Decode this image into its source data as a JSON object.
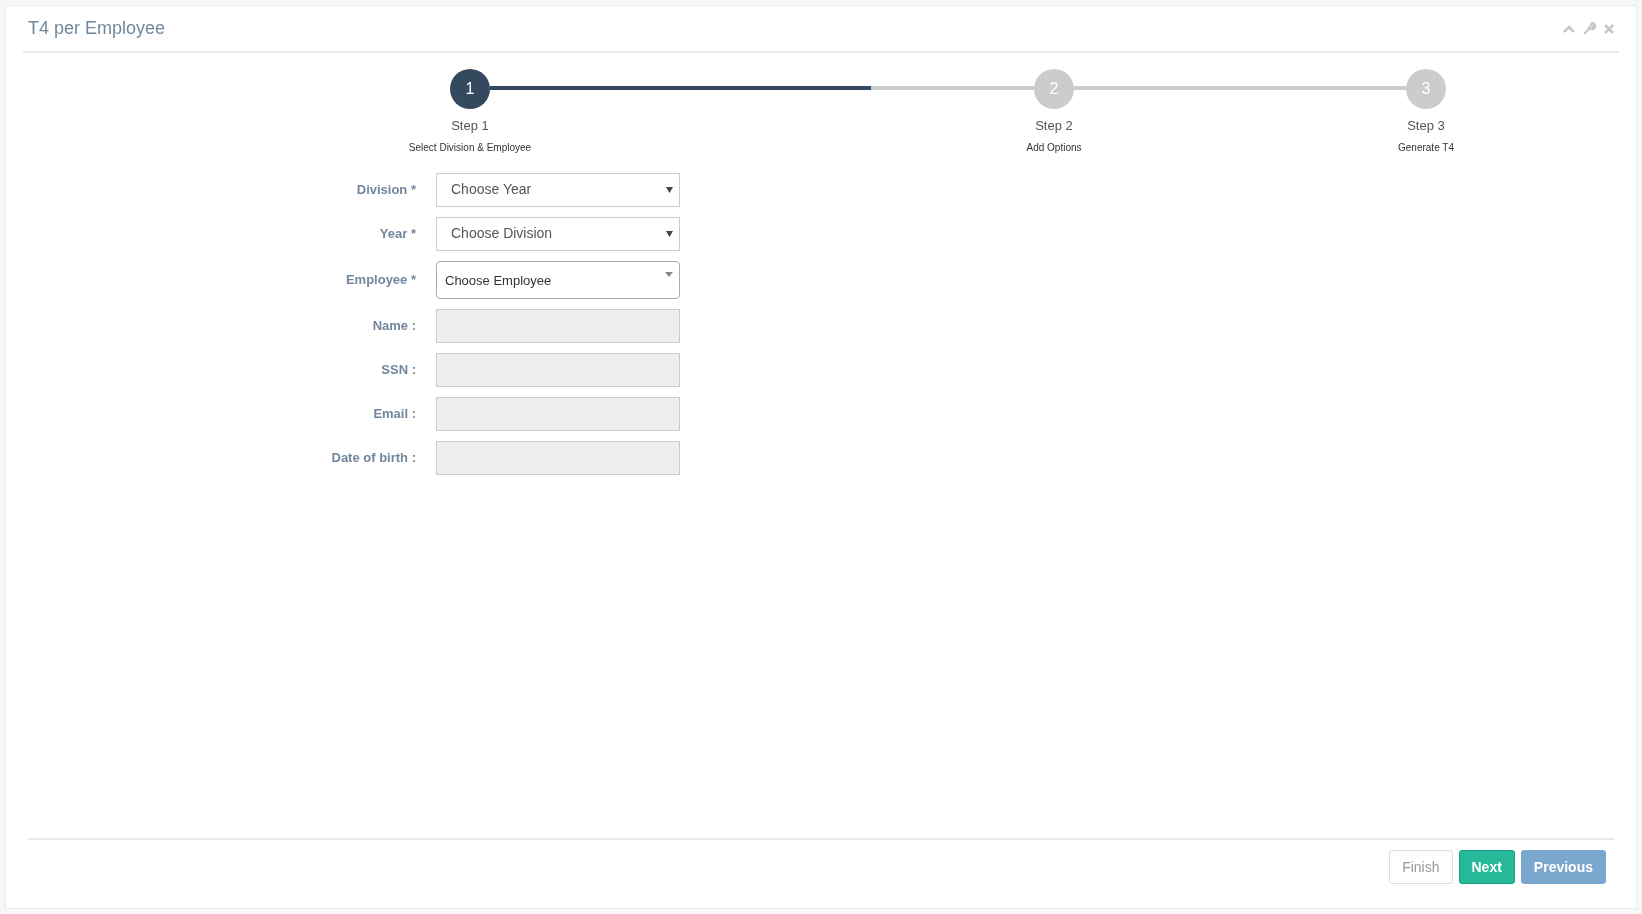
{
  "panel": {
    "title": "T4 per Employee"
  },
  "stepper": {
    "level": 0.7,
    "steps": [
      {
        "number": "1",
        "label": "Step 1",
        "description": "Select Division & Employee",
        "selected": true
      },
      {
        "number": "2",
        "label": "Step 2",
        "description": "Add Options",
        "selected": false
      },
      {
        "number": "3",
        "label": "Step 3",
        "description": "Generate T4",
        "selected": false
      }
    ]
  },
  "form": [
    {
      "label": "Division *",
      "kind": "select",
      "value": "Choose Year"
    },
    {
      "label": "Year *",
      "kind": "select",
      "value": "Choose Division"
    },
    {
      "label": "Employee *",
      "kind": "combo",
      "value": "Choose Employee"
    },
    {
      "label": "Name :",
      "kind": "readonly"
    },
    {
      "label": "SSN :",
      "kind": "readonly"
    },
    {
      "label": "Email :",
      "kind": "readonly"
    },
    {
      "label": "Date of birth :",
      "kind": "readonly"
    }
  ],
  "buttons": [
    {
      "label": "Finish",
      "kind": "default"
    },
    {
      "label": "Next",
      "kind": "success"
    },
    {
      "label": "Previous",
      "kind": "primary"
    }
  ]
}
